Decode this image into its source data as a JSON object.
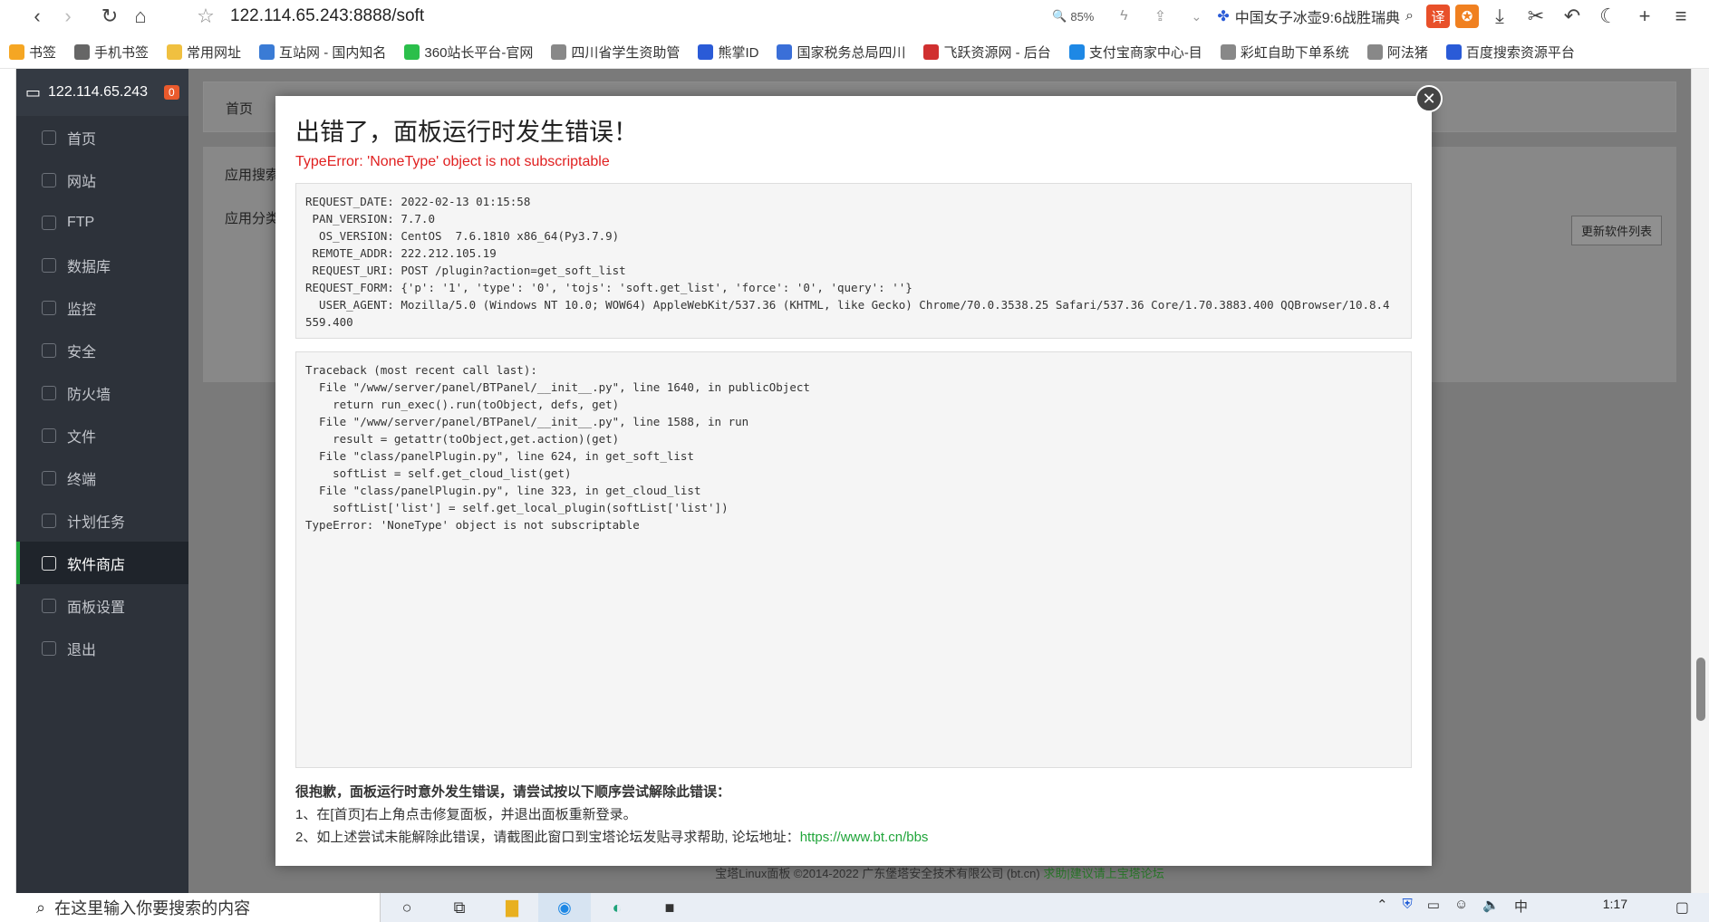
{
  "browser": {
    "address": "122.114.65.243:8888/soft",
    "zoom": "85%",
    "news_headline": "中国女子冰壶9:6战胜瑞典"
  },
  "bookmarks": [
    {
      "label": "书签",
      "color": "#f5a623"
    },
    {
      "label": "手机书签",
      "color": "#666666"
    },
    {
      "label": "常用网址",
      "color": "#f0c040"
    },
    {
      "label": "互站网 - 国内知名",
      "color": "#3a7bd5"
    },
    {
      "label": "360站长平台-官网",
      "color": "#2bbf4b"
    },
    {
      "label": "四川省学生资助管",
      "color": "#888888"
    },
    {
      "label": "熊掌ID",
      "color": "#2a5bd7"
    },
    {
      "label": "国家税务总局四川",
      "color": "#3a6fd8"
    },
    {
      "label": "飞跃资源网 - 后台",
      "color": "#d03030"
    },
    {
      "label": "支付宝商家中心-目",
      "color": "#1e88e5"
    },
    {
      "label": "彩虹自助下单系统",
      "color": "#888888"
    },
    {
      "label": "阿法猪",
      "color": "#888888"
    },
    {
      "label": "百度搜索资源平台",
      "color": "#2a5bd7"
    }
  ],
  "sidebar": {
    "server": "122.114.65.243",
    "badge": "0",
    "items": [
      {
        "label": "首页"
      },
      {
        "label": "网站"
      },
      {
        "label": "FTP"
      },
      {
        "label": "数据库"
      },
      {
        "label": "监控"
      },
      {
        "label": "安全"
      },
      {
        "label": "防火墙"
      },
      {
        "label": "文件"
      },
      {
        "label": "终端"
      },
      {
        "label": "计划任务"
      },
      {
        "label": "软件商店"
      },
      {
        "label": "面板设置"
      },
      {
        "label": "退出"
      }
    ]
  },
  "main": {
    "breadcrumb": "首页",
    "search_label": "应用搜索",
    "category_label": "应用分类",
    "update_button": "更新软件列表",
    "footer_text": "宝塔Linux面板 ©2014-2022 广东堡塔安全技术有限公司 (bt.cn)",
    "footer_link": "求助|建议请上宝塔论坛"
  },
  "modal": {
    "title": "出错了，面板运行时发生错误！",
    "error": "TypeError: 'NoneType' object is not subscriptable",
    "request_info": "REQUEST_DATE: 2022-02-13 01:15:58\n PAN_VERSION: 7.7.0\n  OS_VERSION: CentOS  7.6.1810 x86_64(Py3.7.9)\n REMOTE_ADDR: 222.212.105.19\n REQUEST_URI: POST /plugin?action=get_soft_list\nREQUEST_FORM: {'p': '1', 'type': '0', 'tojs': 'soft.get_list', 'force': '0', 'query': ''}\n  USER_AGENT: Mozilla/5.0 (Windows NT 10.0; WOW64) AppleWebKit/537.36 (KHTML, like Gecko) Chrome/70.0.3538.25 Safari/537.36 Core/1.70.3883.400 QQBrowser/10.8.4\n559.400",
    "traceback": "Traceback (most recent call last):\n  File \"/www/server/panel/BTPanel/__init__.py\", line 1640, in publicObject\n    return run_exec().run(toObject, defs, get)\n  File \"/www/server/panel/BTPanel/__init__.py\", line 1588, in run\n    result = getattr(toObject,get.action)(get)\n  File \"class/panelPlugin.py\", line 624, in get_soft_list\n    softList = self.get_cloud_list(get)\n  File \"class/panelPlugin.py\", line 323, in get_cloud_list\n    softList['list'] = self.get_local_plugin(softList['list'])\nTypeError: 'NoneType' object is not subscriptable",
    "hint_heading": "很抱歉，面板运行时意外发生错误，请尝试按以下顺序尝试解除此错误：",
    "hint_1": "1、在[首页]右上角点击修复面板，并退出面板重新登录。",
    "hint_2": "2、如上述尝试未能解除此错误，请截图此窗口到宝塔论坛发贴寻求帮助, 论坛地址：",
    "forum_url": "https://www.bt.cn/bbs"
  },
  "taskbar": {
    "search_placeholder": "在这里输入你要搜索的内容",
    "time": "1:17",
    "ime": "中"
  }
}
